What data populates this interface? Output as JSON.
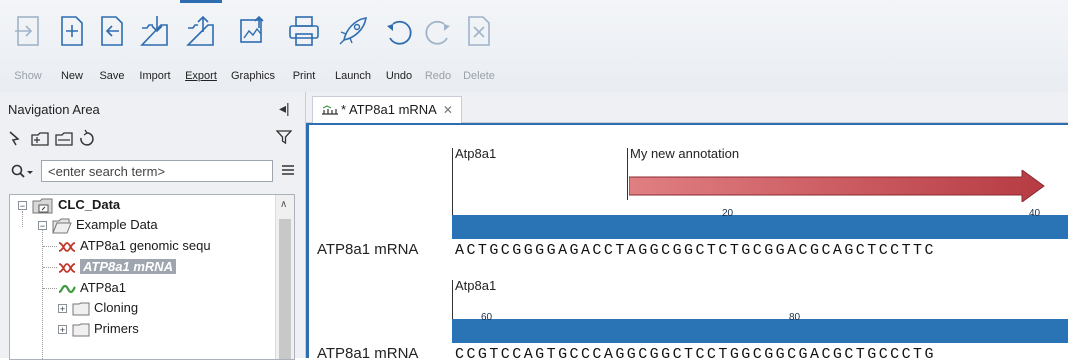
{
  "toolbar": {
    "buttons": [
      {
        "label": "Show",
        "icon": "show-icon",
        "enabled": false
      },
      {
        "label": "New",
        "icon": "new-icon",
        "enabled": true
      },
      {
        "label": "Save",
        "icon": "save-icon",
        "enabled": true
      },
      {
        "label": "Import",
        "icon": "import-icon",
        "enabled": true
      },
      {
        "label": "Export",
        "icon": "export-icon",
        "enabled": true,
        "active": true
      },
      {
        "label": "Graphics",
        "icon": "graphics-icon",
        "enabled": true
      },
      {
        "label": "Print",
        "icon": "print-icon",
        "enabled": true
      },
      {
        "label": "Launch",
        "icon": "launch-icon",
        "enabled": true
      },
      {
        "label": "Undo",
        "icon": "undo-icon",
        "enabled": true
      },
      {
        "label": "Redo",
        "icon": "redo-icon",
        "enabled": false
      },
      {
        "label": "Delete",
        "icon": "delete-icon",
        "enabled": false
      }
    ]
  },
  "navigation": {
    "title": "Navigation Area",
    "search_placeholder": "<enter search term>",
    "tree": {
      "root": "CLC_Data",
      "folder": "Example Data",
      "items": [
        "ATP8a1 genomic sequ",
        "ATP8a1 mRNA",
        "ATP8a1"
      ],
      "subfolders": [
        "Cloning",
        "Primers"
      ]
    }
  },
  "editor": {
    "tab_label": "* ATP8a1 mRNA",
    "rows": [
      {
        "annotations": [
          "Atp8a1",
          "My new annotation"
        ],
        "ticks": [
          "20",
          "40"
        ],
        "seq_name": "ATP8a1 mRNA",
        "sequence": "ACTGCGGGGAGACCTAGGCGGCTCTGCGGACGCAGCTCCTTC"
      },
      {
        "annotations": [
          "Atp8a1"
        ],
        "ticks": [
          "60",
          "80"
        ],
        "seq_name": "ATP8a1 mRNA",
        "sequence": "CCGTCCAGTGCCCAGGCGGCTCCTGGCGGCGACGCTGCCCTG"
      }
    ]
  },
  "colors": {
    "accent": "#2e6db0",
    "track": "#2a73b4",
    "annotation_arrow": "#c9444b"
  }
}
